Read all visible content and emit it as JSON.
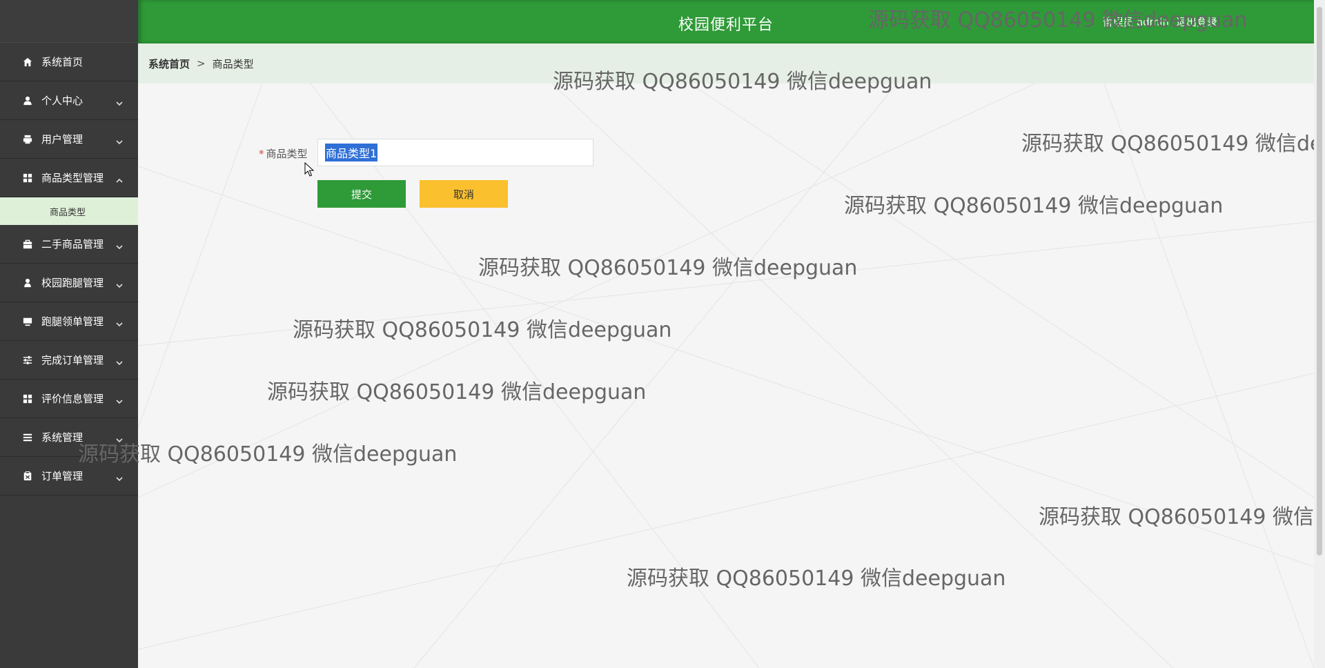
{
  "header": {
    "title": "校园便利平台",
    "user_label": "管理员 admin",
    "logout_label": "退出登录"
  },
  "breadcrumb": {
    "home": "系统首页",
    "separator": ">",
    "current": "商品类型"
  },
  "sidebar": {
    "items": [
      {
        "label": "系统首页",
        "icon": "home-icon"
      },
      {
        "label": "个人中心",
        "icon": "user-icon"
      },
      {
        "label": "用户管理",
        "icon": "printer-icon"
      },
      {
        "label": "商品类型管理",
        "icon": "grid-icon"
      },
      {
        "label": "二手商品管理",
        "icon": "briefcase-icon"
      },
      {
        "label": "校园跑腿管理",
        "icon": "person-icon"
      },
      {
        "label": "跑腿领单管理",
        "icon": "monitor-icon"
      },
      {
        "label": "完成订单管理",
        "icon": "sliders-icon"
      },
      {
        "label": "评价信息管理",
        "icon": "grid-icon"
      },
      {
        "label": "系统管理",
        "icon": "list-icon"
      },
      {
        "label": "订单管理",
        "icon": "clipboard-icon"
      }
    ],
    "submenu": {
      "label": "商品类型"
    }
  },
  "form": {
    "field_label": "商品类型",
    "required_mark": "*",
    "field_value": "商品类型1",
    "submit_label": "提交",
    "cancel_label": "取消"
  },
  "watermark": {
    "text": "源码获取 QQ86050149 微信deepguan",
    "text_cut1": "源码获取 QQ86050149 微信dee",
    "text_cut2": "源码获取 QQ86050149 微信de"
  },
  "colors": {
    "primary_green": "#2f9a38",
    "sidebar_bg": "#3a3a3a",
    "cancel_yellow": "#fbc02d",
    "submenu_bg": "#dff0d8",
    "breadcrumb_bg": "#e6efe6"
  }
}
